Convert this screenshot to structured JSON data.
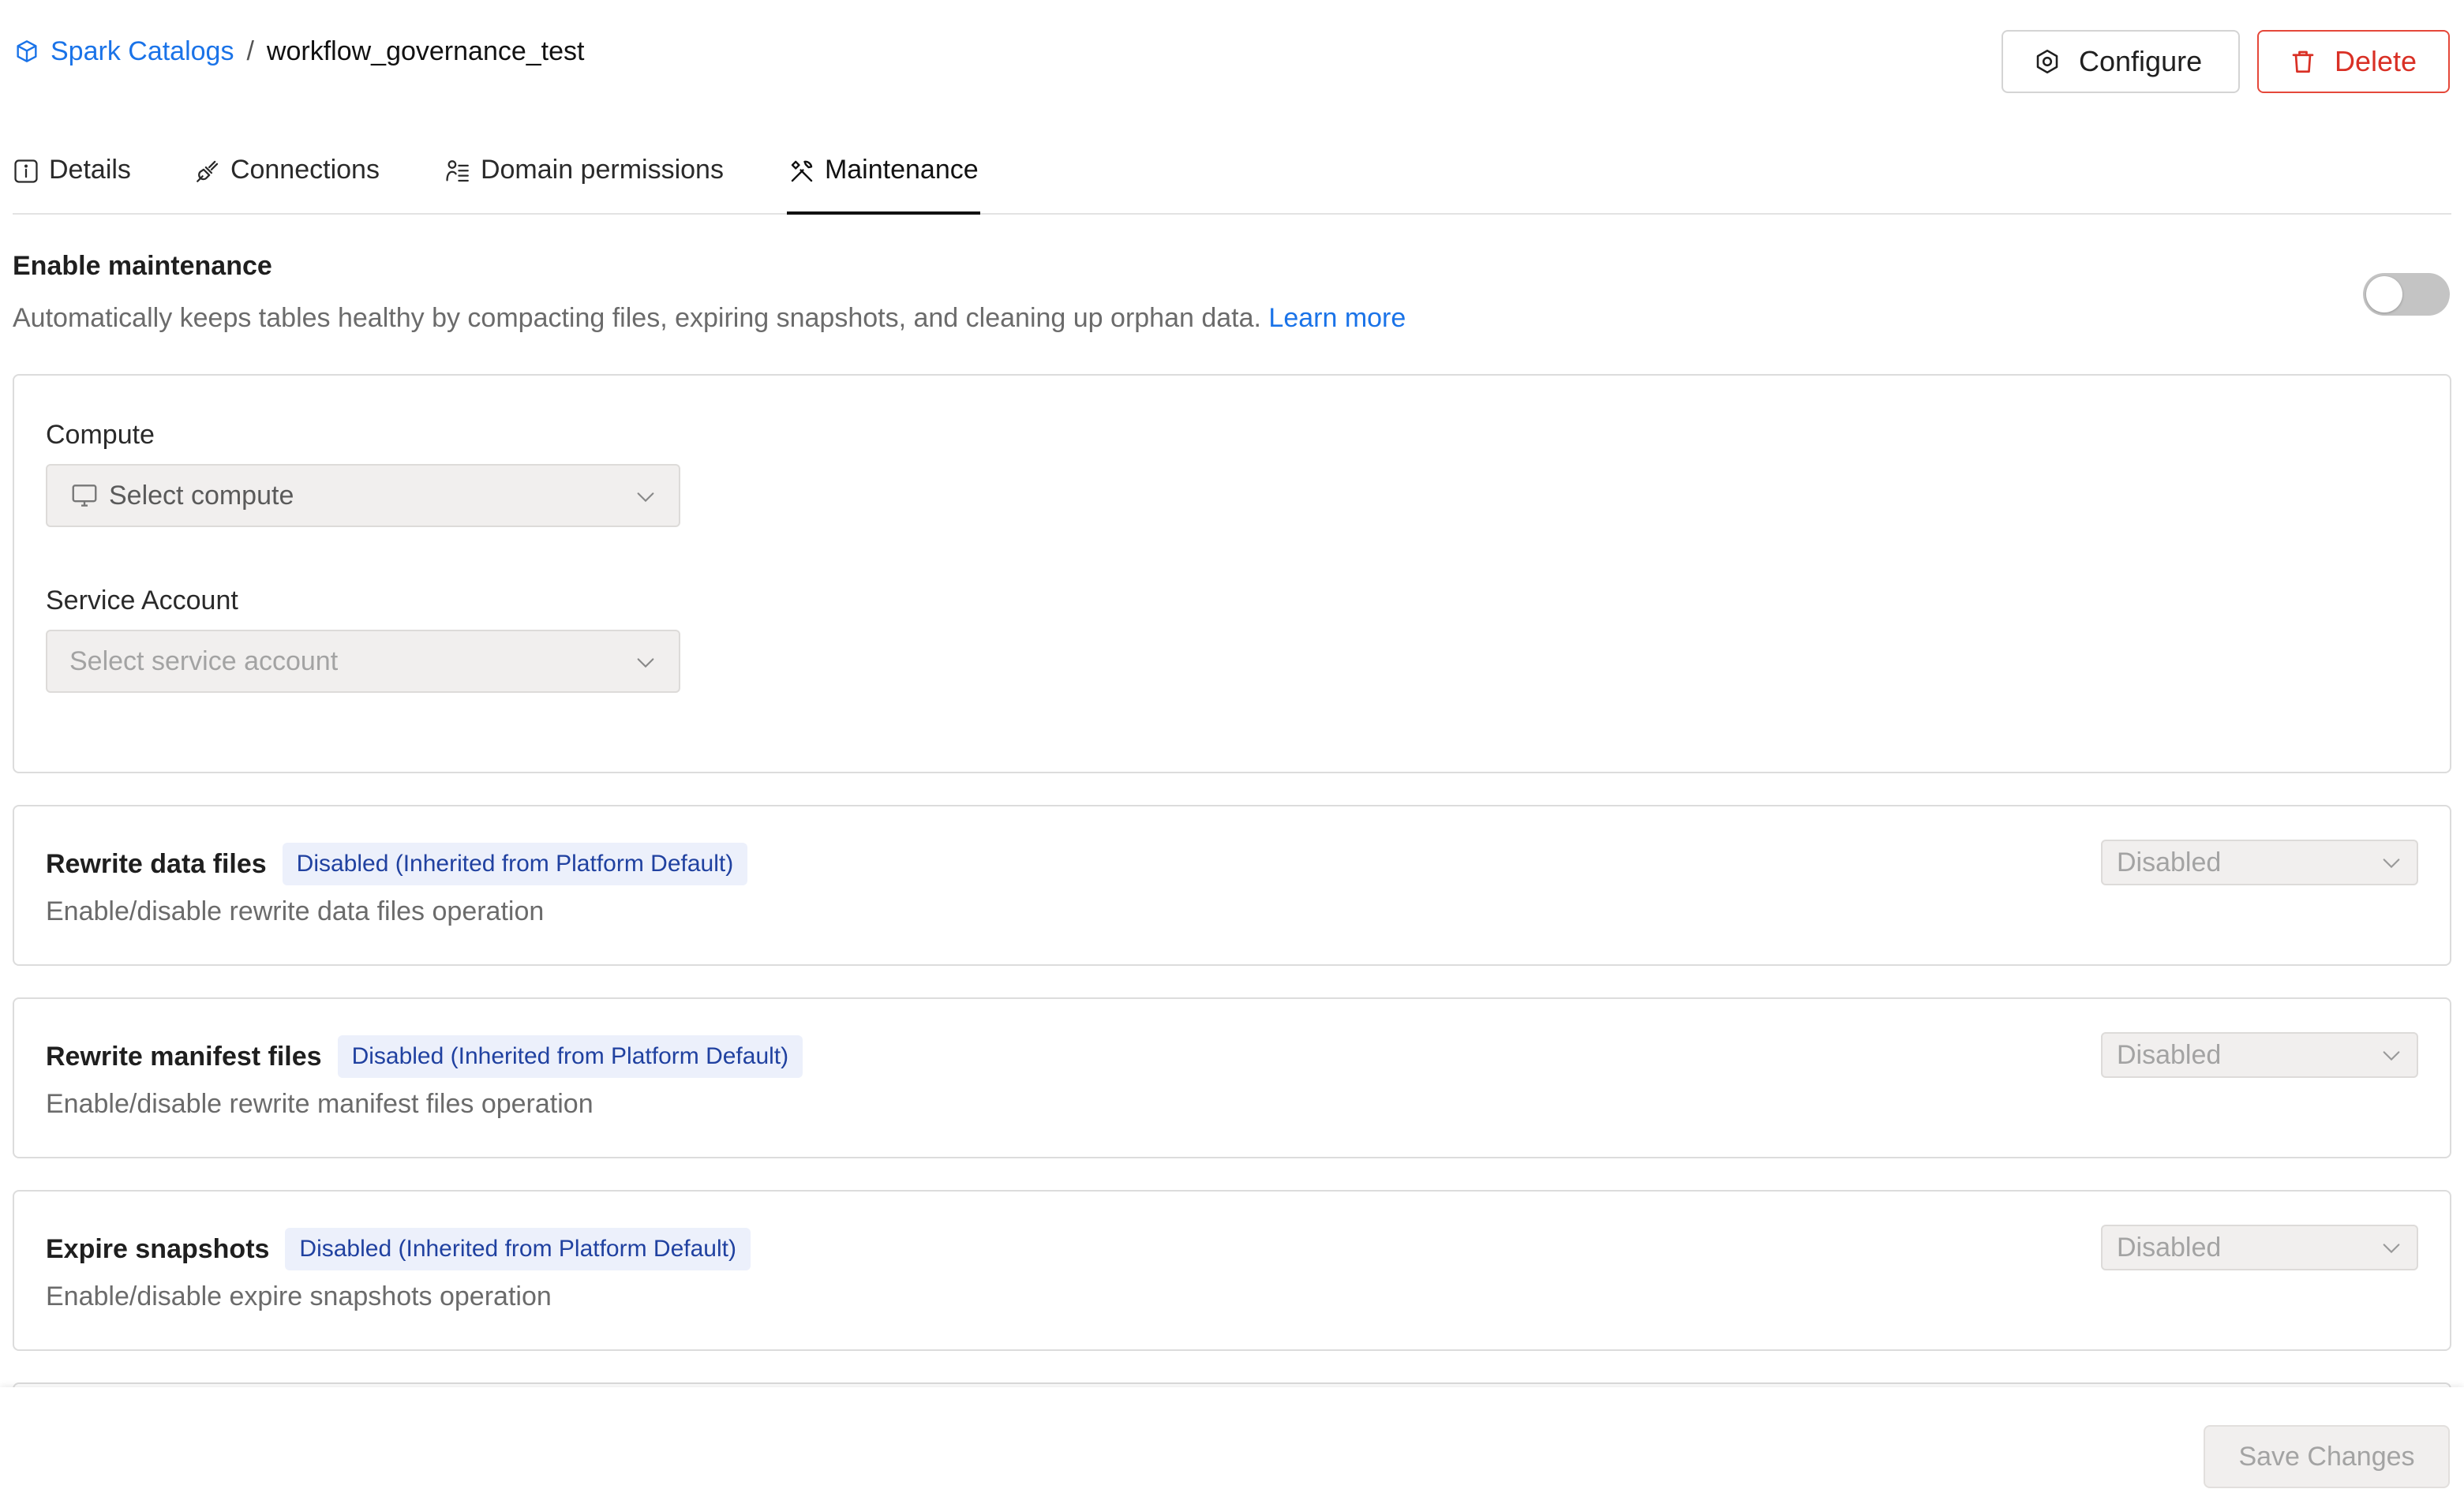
{
  "breadcrumb": {
    "parent": "Spark Catalogs",
    "separator": "/",
    "current": "workflow_governance_test"
  },
  "header": {
    "configure_label": "Configure",
    "delete_label": "Delete"
  },
  "tabs": [
    {
      "label": "Details",
      "icon": "info-icon"
    },
    {
      "label": "Connections",
      "icon": "plug-icon"
    },
    {
      "label": "Domain permissions",
      "icon": "domain-permissions-icon"
    },
    {
      "label": "Maintenance",
      "icon": "tools-icon",
      "active": true
    }
  ],
  "maintenance": {
    "title": "Enable maintenance",
    "description": "Automatically keeps tables healthy by compacting files, expiring snapshots, and cleaning up orphan data.",
    "learn_more": "Learn more",
    "enabled": false
  },
  "compute": {
    "label": "Compute",
    "placeholder": "Select compute"
  },
  "service_account": {
    "label": "Service Account",
    "placeholder": "Select service account"
  },
  "operations": [
    {
      "name": "Rewrite data files",
      "badge": "Disabled (Inherited from Platform Default)",
      "description": "Enable/disable rewrite data files operation",
      "value": "Disabled"
    },
    {
      "name": "Rewrite manifest files",
      "badge": "Disabled (Inherited from Platform Default)",
      "description": "Enable/disable rewrite manifest files operation",
      "value": "Disabled"
    },
    {
      "name": "Expire snapshots",
      "badge": "Disabled (Inherited from Platform Default)",
      "description": "Enable/disable expire snapshots operation",
      "value": "Disabled"
    }
  ],
  "footer": {
    "save_label": "Save Changes"
  },
  "colors": {
    "link": "#1a73e8",
    "danger": "#d93025",
    "badge_bg": "#ecf0fb",
    "badge_text": "#2041a0"
  }
}
